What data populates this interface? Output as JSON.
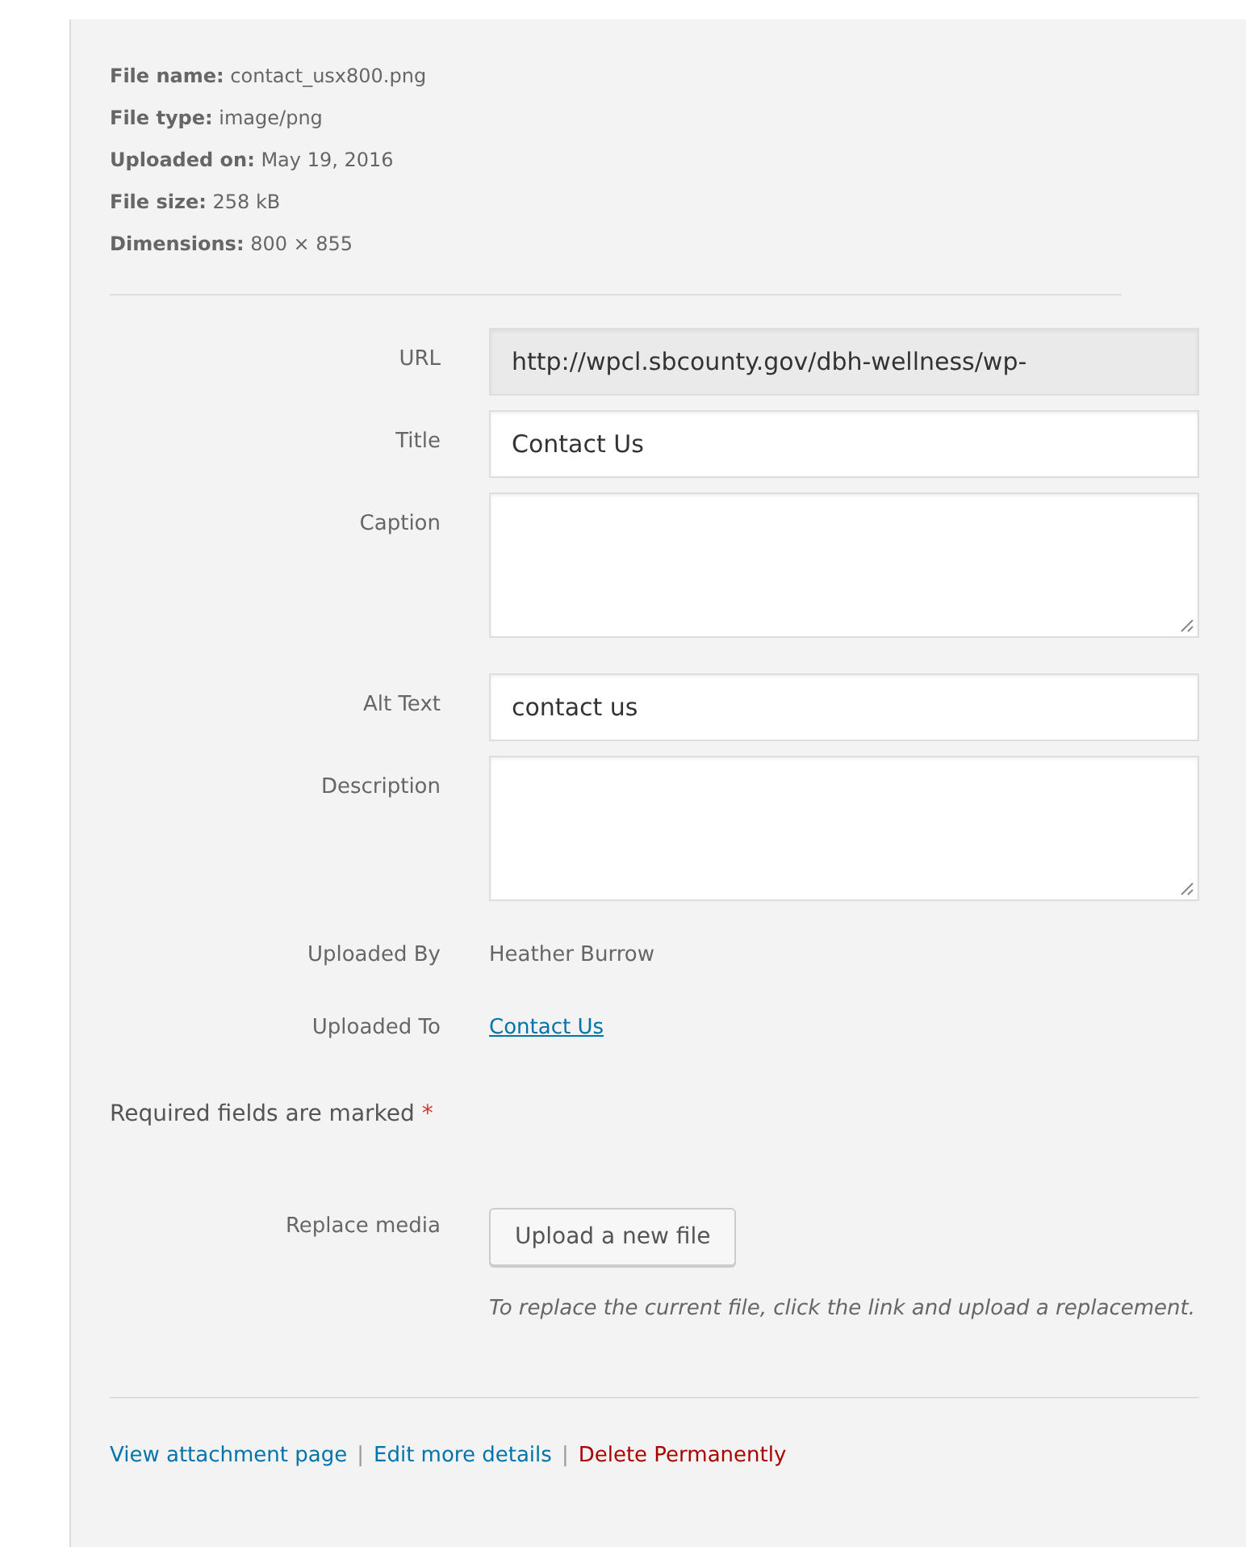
{
  "file_info": [
    {
      "label": "File name:",
      "value": "contact_usx800.png"
    },
    {
      "label": "File type:",
      "value": "image/png"
    },
    {
      "label": "Uploaded on:",
      "value": "May 19, 2016"
    },
    {
      "label": "File size:",
      "value": "258 kB"
    },
    {
      "label": "Dimensions:",
      "value": "800 × 855"
    }
  ],
  "fields": [
    {
      "label": "URL",
      "kind": "readonly",
      "value": "http://wpcl.sbcounty.gov/dbh-wellness/wp-"
    },
    {
      "label": "Title",
      "kind": "text",
      "value": "Contact Us"
    },
    {
      "label": "Caption",
      "kind": "textarea"
    },
    {
      "label": "Alt Text",
      "kind": "text",
      "value": "contact us"
    },
    {
      "label": "Description",
      "kind": "textarea"
    },
    {
      "label": "Uploaded By",
      "kind": "plain",
      "value": "Heather Burrow"
    },
    {
      "label": "Uploaded To",
      "kind": "link",
      "value": "Contact Us"
    }
  ],
  "required_note": {
    "text": "Required fields are marked",
    "mark": "*"
  },
  "replace_media": {
    "label": "Replace media",
    "button": "Upload a new file",
    "hint": "To replace the current file, click the link and upload a replacement."
  },
  "actions": [
    {
      "label": "View attachment page",
      "kind": "link"
    },
    {
      "label": "Edit more details",
      "kind": "link"
    },
    {
      "label": "Delete Permanently",
      "kind": "danger"
    }
  ],
  "separator": "|"
}
